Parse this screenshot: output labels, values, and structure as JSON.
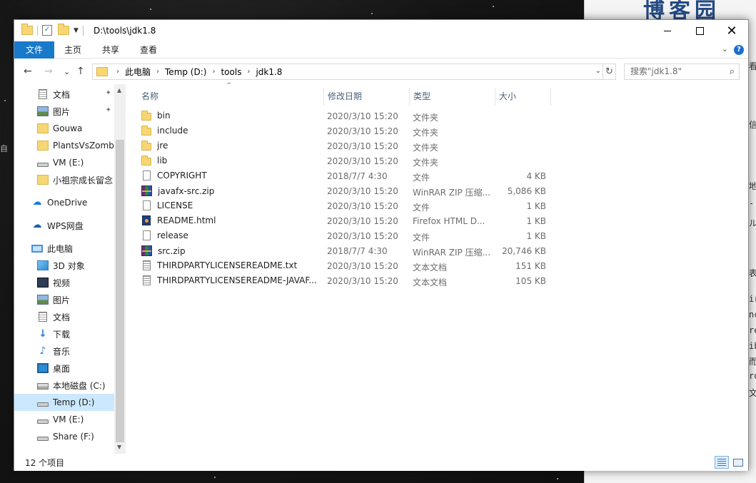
{
  "background": {
    "blog_title": "博客园",
    "side_chars": [
      "看",
      "信",
      "地",
      "-",
      "ル",
      "表",
      "ir",
      "nc",
      "re",
      "ib",
      "而",
      "ro",
      "文"
    ],
    "left_char": "自"
  },
  "window": {
    "title_path": "D:\\tools\\jdk1.8",
    "quick_access": {
      "properties_icon": "check-icon",
      "new_folder_icon": "folder-icon",
      "customize_icon": "chevron-down-icon"
    },
    "buttons": {
      "minimize": "minimize",
      "maximize": "maximize",
      "close": "✕"
    }
  },
  "ribbon": {
    "tabs": [
      "文件",
      "主页",
      "共享",
      "查看"
    ],
    "expand_glyph": "⌄",
    "help_glyph": "?"
  },
  "navbar": {
    "back": "←",
    "forward": "→",
    "recent": "⌄",
    "up": "↑",
    "breadcrumbs": [
      "此电脑",
      "Temp (D:)",
      "tools",
      "jdk1.8"
    ],
    "refresh": "↻",
    "dropdown": "⌄",
    "search_placeholder": "搜索\"jdk1.8\"",
    "search_icon": "⌕"
  },
  "navpane": {
    "items": [
      {
        "label": "文档",
        "icon": "document-icon",
        "pinned": true
      },
      {
        "label": "图片",
        "icon": "picture-icon",
        "pinned": true
      },
      {
        "label": "Gouwa",
        "icon": "folder-icon"
      },
      {
        "label": "PlantsVsZombi",
        "icon": "folder-icon"
      },
      {
        "label": "VM (E:)",
        "icon": "drive-icon"
      },
      {
        "label": "小祖宗成长留念",
        "icon": "folder-icon"
      },
      {
        "label": "OneDrive",
        "icon": "cloud-icon"
      },
      {
        "label": "WPS网盘",
        "icon": "cloud-icon"
      },
      {
        "label": "此电脑",
        "icon": "computer-icon"
      },
      {
        "label": "3D 对象",
        "icon": "cube-icon"
      },
      {
        "label": "视频",
        "icon": "video-icon"
      },
      {
        "label": "图片",
        "icon": "picture-icon"
      },
      {
        "label": "文档",
        "icon": "document-icon"
      },
      {
        "label": "下载",
        "icon": "download-icon"
      },
      {
        "label": "音乐",
        "icon": "music-icon"
      },
      {
        "label": "桌面",
        "icon": "desktop-icon"
      },
      {
        "label": "本地磁盘 (C:)",
        "icon": "windows-drive-icon"
      },
      {
        "label": "Temp (D:)",
        "icon": "drive-icon",
        "selected": true
      },
      {
        "label": "VM (E:)",
        "icon": "drive-icon"
      },
      {
        "label": "Share (F:)",
        "icon": "drive-icon"
      }
    ],
    "pin_glyph": "📌",
    "scroll_up": "▲",
    "scroll_down": "▼"
  },
  "filelist": {
    "sort_glyph": "^",
    "columns": [
      "名称",
      "修改日期",
      "类型",
      "大小"
    ],
    "rows": [
      {
        "name": "bin",
        "date": "2020/3/10 15:20",
        "type": "文件夹",
        "size": "",
        "icon": "folder-icon"
      },
      {
        "name": "include",
        "date": "2020/3/10 15:20",
        "type": "文件夹",
        "size": "",
        "icon": "folder-icon"
      },
      {
        "name": "jre",
        "date": "2020/3/10 15:20",
        "type": "文件夹",
        "size": "",
        "icon": "folder-icon"
      },
      {
        "name": "lib",
        "date": "2020/3/10 15:20",
        "type": "文件夹",
        "size": "",
        "icon": "folder-icon"
      },
      {
        "name": "COPYRIGHT",
        "date": "2018/7/7 4:30",
        "type": "文件",
        "size": "4 KB",
        "icon": "file-icon"
      },
      {
        "name": "javafx-src.zip",
        "date": "2020/3/10 15:20",
        "type": "WinRAR ZIP 压缩...",
        "size": "5,086 KB",
        "icon": "zip-icon"
      },
      {
        "name": "LICENSE",
        "date": "2020/3/10 15:20",
        "type": "文件",
        "size": "1 KB",
        "icon": "file-icon"
      },
      {
        "name": "README.html",
        "date": "2020/3/10 15:20",
        "type": "Firefox HTML D...",
        "size": "1 KB",
        "icon": "html-icon"
      },
      {
        "name": "release",
        "date": "2020/3/10 15:20",
        "type": "文件",
        "size": "1 KB",
        "icon": "file-icon"
      },
      {
        "name": "src.zip",
        "date": "2018/7/7 4:30",
        "type": "WinRAR ZIP 压缩...",
        "size": "20,746 KB",
        "icon": "zip-icon"
      },
      {
        "name": "THIRDPARTYLICENSEREADME.txt",
        "date": "2020/3/10 15:20",
        "type": "文本文档",
        "size": "151 KB",
        "icon": "text-file-icon"
      },
      {
        "name": "THIRDPARTYLICENSEREADME-JAVAF...",
        "date": "2020/3/10 15:20",
        "type": "文本文档",
        "size": "105 KB",
        "icon": "text-file-icon"
      }
    ]
  },
  "status": {
    "item_count": "12 个项目"
  }
}
